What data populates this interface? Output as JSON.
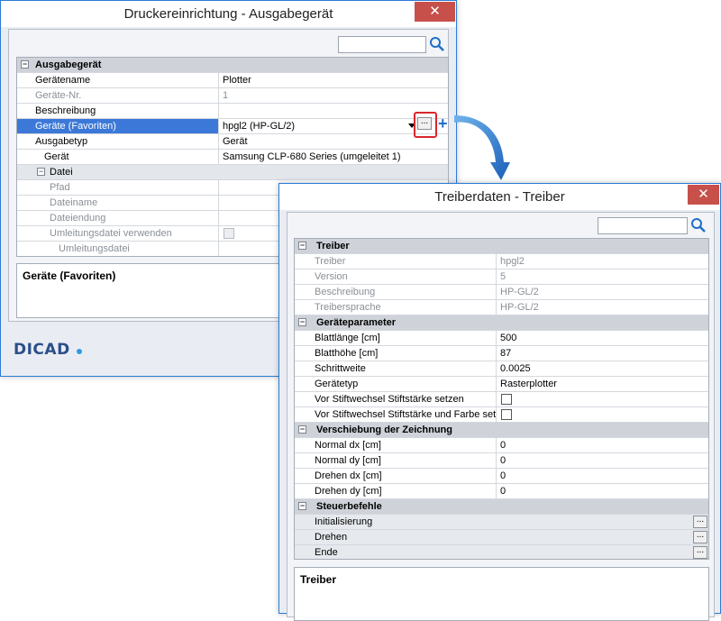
{
  "win1": {
    "title": "Druckereinrichtung - Ausgabegerät",
    "close": "✕",
    "category": "Ausgabegerät",
    "rows": [
      {
        "label": "Gerätename",
        "value": "Plotter"
      },
      {
        "label": "Geräte-Nr.",
        "value": "1"
      },
      {
        "label": "Beschreibung",
        "value": ""
      },
      {
        "label": "Geräte (Favoriten)",
        "value": "hpgl2 (HP-GL/2)"
      },
      {
        "label": "Ausgabetyp",
        "value": "Gerät"
      },
      {
        "label": "Gerät",
        "value": "Samsung CLP-680 Series (umgeleitet 1)"
      }
    ],
    "subcategory": "Datei",
    "file_rows": [
      "Pfad",
      "Dateiname",
      "Dateiendung",
      "Umleitungsdatei verwenden",
      "Umleitungsdatei"
    ],
    "description_title": "Geräte (Favoriten)",
    "logo": "DICAD",
    "dots": "...",
    "plus": "+"
  },
  "win2": {
    "title": "Treiberdaten - Treiber",
    "close": "✕",
    "cat_treiber": "Treiber",
    "treiber_rows": [
      {
        "label": "Treiber",
        "value": "hpgl2"
      },
      {
        "label": "Version",
        "value": "5"
      },
      {
        "label": "Beschreibung",
        "value": "HP-GL/2"
      },
      {
        "label": "Treibersprache",
        "value": "HP-GL/2"
      }
    ],
    "cat_param": "Geräteparameter",
    "param_rows": [
      {
        "label": "Blattlänge [cm]",
        "value": "500"
      },
      {
        "label": "Blatthöhe [cm]",
        "value": "87"
      },
      {
        "label": "Schrittweite",
        "value": "0.0025"
      },
      {
        "label": "Gerätetyp",
        "value": "Rasterplotter"
      },
      {
        "label": "Vor Stiftwechsel Stiftstärke setzen",
        "value": ""
      },
      {
        "label": "Vor Stiftwechsel Stiftstärke und Farbe setzen",
        "value": ""
      }
    ],
    "cat_shift": "Verschiebung der Zeichnung",
    "shift_rows": [
      {
        "label": "Normal dx [cm]",
        "value": "0"
      },
      {
        "label": "Normal dy [cm]",
        "value": "0"
      },
      {
        "label": "Drehen dx [cm]",
        "value": "0"
      },
      {
        "label": "Drehen dy [cm]",
        "value": "0"
      }
    ],
    "cat_ctrl": "Steuerbefehle",
    "ctrl_rows": [
      "Initialisierung",
      "Drehen",
      "Ende"
    ],
    "description_title": "Treiber",
    "dots": "..."
  },
  "colors": {
    "accent": "#2b7bd6",
    "selection": "#3c78d8",
    "highlight": "#d9262c",
    "close": "#c7504a"
  }
}
